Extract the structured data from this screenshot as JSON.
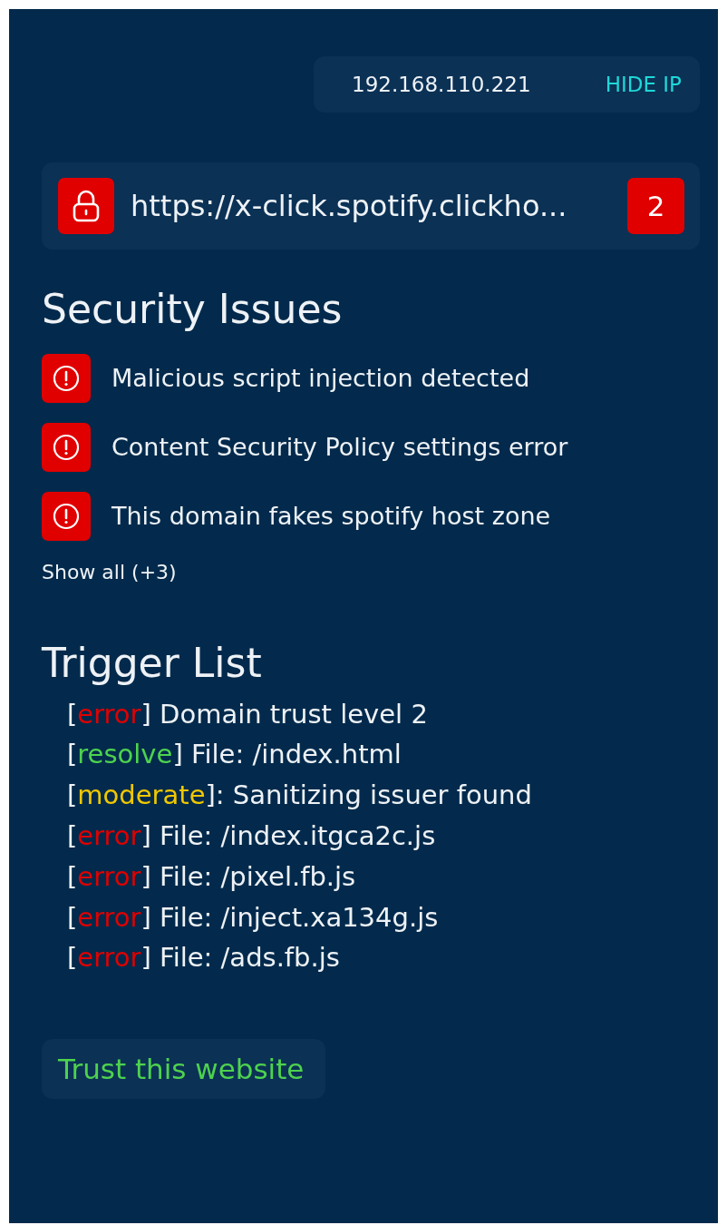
{
  "ip_bar": {
    "ip": "192.168.110.221",
    "action": "HIDE IP"
  },
  "url_bar": {
    "url": "https://x-click.spotify.clickho...",
    "count": "2"
  },
  "security_issues": {
    "title": "Security Issues",
    "items": [
      {
        "text": "Malicious script injection detected"
      },
      {
        "text": "Content Security Policy settings error"
      },
      {
        "text": "This domain fakes spotify host zone"
      }
    ],
    "show_all": "Show all (+3)"
  },
  "trigger_list": {
    "title": "Trigger List",
    "items": [
      {
        "kind": "error",
        "open": "[",
        "tag": "error",
        "rest": "] Domain trust level 2"
      },
      {
        "kind": "resolve",
        "open": "[",
        "tag": "resolve",
        "rest": "] File: /index.html"
      },
      {
        "kind": "moderate",
        "open": "[",
        "tag": "moderate",
        "rest": "]: Sanitizing issuer found"
      },
      {
        "kind": "error",
        "open": "[",
        "tag": "error",
        "rest": "] File: /index.itgca2c.js"
      },
      {
        "kind": "error",
        "open": "[",
        "tag": "error",
        "rest": "] File: /pixel.fb.js"
      },
      {
        "kind": "error",
        "open": "[",
        "tag": "error",
        "rest": "] File: /inject.xa134g.js"
      },
      {
        "kind": "error",
        "open": "[",
        "tag": "error",
        "rest": "] File: /ads.fb.js"
      }
    ]
  },
  "trust_button": "Trust this website"
}
